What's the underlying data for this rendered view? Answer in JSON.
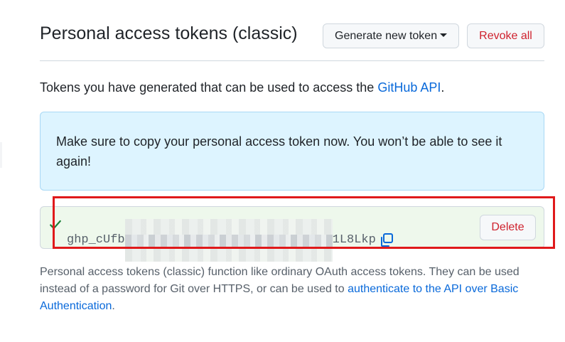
{
  "header": {
    "title": "Personal access tokens (classic)",
    "generate_label": "Generate new token",
    "revoke_label": "Revoke all"
  },
  "intro": {
    "text_before": "Tokens you have generated that can be used to access the ",
    "link_text": "GitHub API",
    "text_after": "."
  },
  "flash": {
    "message": "Make sure to copy your personal access token now. You won’t be able to see it again!"
  },
  "token": {
    "prefix": "ghp_cUfb",
    "suffix": "1L8Lkp",
    "delete_label": "Delete",
    "icons": [
      "check-icon",
      "copy-icon"
    ]
  },
  "footnote": {
    "text_before": "Personal access tokens (classic) function like ordinary OAuth access tokens. They can be used instead of a password for Git over HTTPS, or can be used to ",
    "link_text": "authenticate to the API over Basic Authentication",
    "text_after": "."
  },
  "colors": {
    "link": "#0969da",
    "danger": "#cf222e",
    "flash_bg": "#ddf4ff",
    "token_bg": "#eef8ec",
    "highlight": "#e0191b",
    "success": "#1a7f37"
  }
}
